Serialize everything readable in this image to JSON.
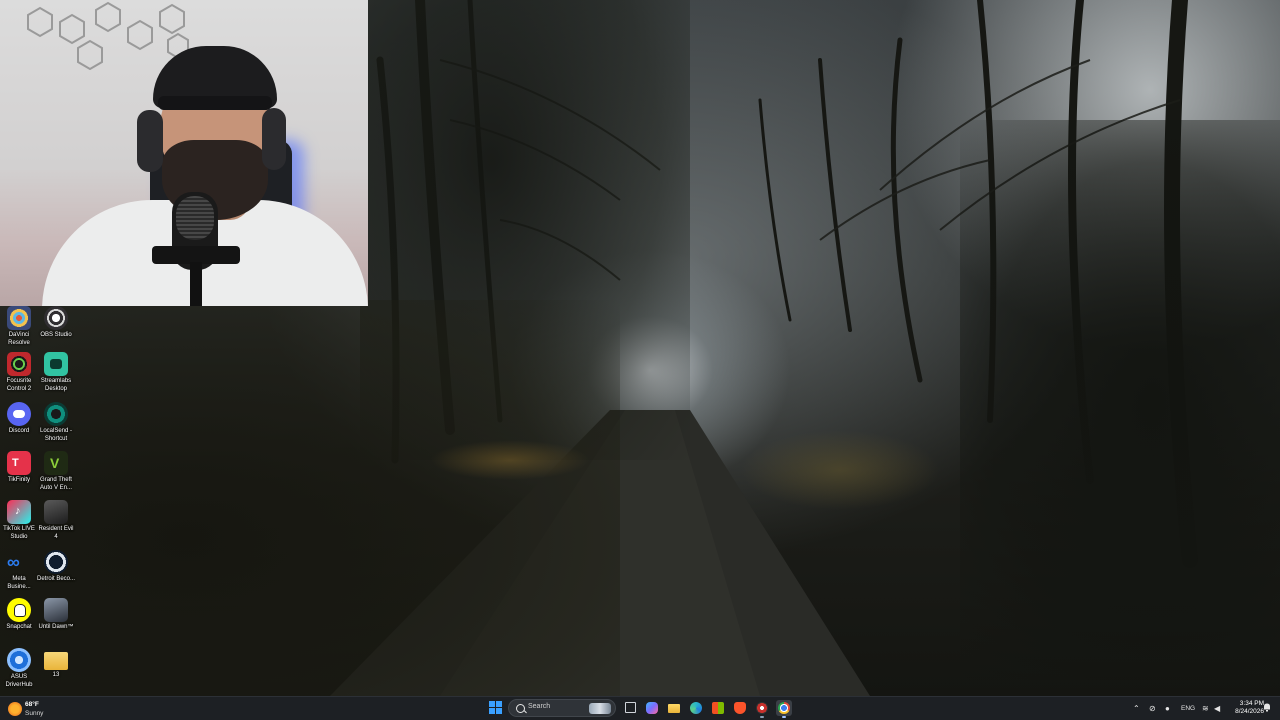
{
  "desktop": {
    "icons": [
      {
        "label": "DaVinci Resolve",
        "icon": "davinci-resolve-icon",
        "color": "#3a4a7a"
      },
      {
        "label": "OBS Studio",
        "icon": "obs-studio-icon",
        "color": "#302e31"
      },
      {
        "label": "Focusrite Control 2",
        "icon": "focusrite-icon",
        "color": "#c0282d"
      },
      {
        "label": "Streamlabs Desktop",
        "icon": "streamlabs-icon",
        "color": "#31c3a2"
      },
      {
        "label": "Discord",
        "icon": "discord-icon",
        "color": "#5865f2"
      },
      {
        "label": "LocalSend - Shortcut",
        "icon": "localsend-icon",
        "color": "#0f8f7e"
      },
      {
        "label": "TikFinity",
        "icon": "tikfinity-icon",
        "color": "#e5324a"
      },
      {
        "label": "Grand Theft Auto V En...",
        "icon": "gta-v-icon",
        "color": "#2b5a1e"
      },
      {
        "label": "TikTok LIVE Studio",
        "icon": "tiktok-live-icon",
        "color": "#fe2c55"
      },
      {
        "label": "Resident Evil 4",
        "icon": "resident-evil-4-icon",
        "color": "#3b3b3b"
      },
      {
        "label": "Meta Busine...",
        "icon": "meta-business-icon",
        "color": "#0a66e4"
      },
      {
        "label": "Detroit Beco...",
        "icon": "detroit-icon",
        "color": "#0f1c2e"
      },
      {
        "label": "Snapchat",
        "icon": "snapchat-icon",
        "color": "#fffc00"
      },
      {
        "label": "Until Dawn™",
        "icon": "until-dawn-icon",
        "color": "#3e4450"
      },
      {
        "label": "ASUS DriverHub",
        "icon": "asus-driverhub-icon",
        "color": "#1e6fd9"
      },
      {
        "label": "13",
        "icon": "folder-icon",
        "color": "#f2c14e"
      }
    ]
  },
  "taskbar": {
    "weather": {
      "temp": "68°F",
      "condition": "Sunny",
      "icon": "sun-icon"
    },
    "search": {
      "placeholder": "Search"
    },
    "apps": [
      {
        "name": "start-menu",
        "icon": "windows-icon"
      },
      {
        "name": "task-view",
        "icon": "task-view-icon",
        "color": "#d0d4da"
      },
      {
        "name": "copilot",
        "icon": "copilot-icon",
        "color": "#7b6cff"
      },
      {
        "name": "file-explorer",
        "icon": "file-explorer-icon",
        "color": "#f3c54e"
      },
      {
        "name": "edge",
        "icon": "edge-icon",
        "color": "#2ab6c9"
      },
      {
        "name": "microsoft-store",
        "icon": "store-icon",
        "color": "#e8e8e8"
      },
      {
        "name": "brave",
        "icon": "brave-icon",
        "color": "#fb542b"
      },
      {
        "name": "obs",
        "icon": "obs-icon",
        "color": "#c9302c"
      },
      {
        "name": "chrome",
        "icon": "chrome-icon",
        "color": "#e24a3b"
      }
    ],
    "tray": {
      "language": "ENG",
      "time": "3:34 PM",
      "date": "8/24/2026"
    }
  },
  "colors": {
    "taskbar_bg": "#1d2024",
    "accent": "#3aa0ff"
  }
}
